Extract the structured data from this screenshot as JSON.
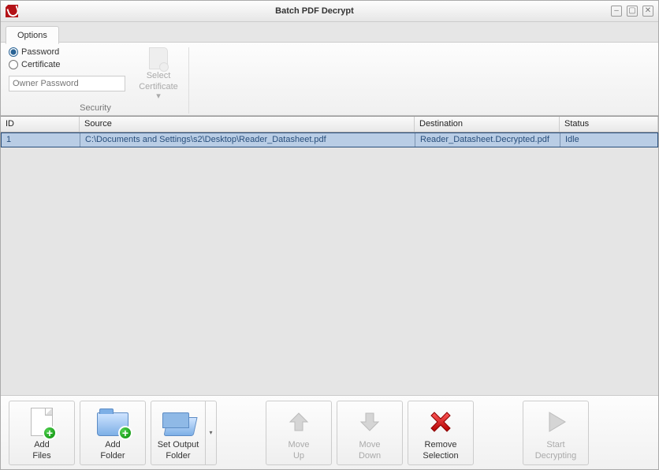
{
  "window": {
    "title": "Batch PDF Decrypt"
  },
  "ribbon": {
    "tab_label": "Options",
    "group_label": "Security",
    "radio_password": "Password",
    "radio_certificate": "Certificate",
    "owner_placeholder": "Owner Password",
    "select_cert_line1": "Select",
    "select_cert_line2": "Certificate"
  },
  "columns": {
    "id": "ID",
    "source": "Source",
    "destination": "Destination",
    "status": "Status"
  },
  "rows": [
    {
      "id": "1",
      "source": "C:\\Documents and Settings\\s2\\Desktop\\Reader_Datasheet.pdf",
      "destination": "Reader_Datasheet.Decrypted.pdf",
      "status": "Idle"
    }
  ],
  "toolbar": {
    "add_files_l1": "Add",
    "add_files_l2": "Files",
    "add_folder_l1": "Add",
    "add_folder_l2": "Folder",
    "set_output_l1": "Set Output",
    "set_output_l2": "Folder",
    "move_up_l1": "Move",
    "move_up_l2": "Up",
    "move_down_l1": "Move",
    "move_down_l2": "Down",
    "remove_l1": "Remove",
    "remove_l2": "Selection",
    "start_l1": "Start",
    "start_l2": "Decrypting"
  }
}
